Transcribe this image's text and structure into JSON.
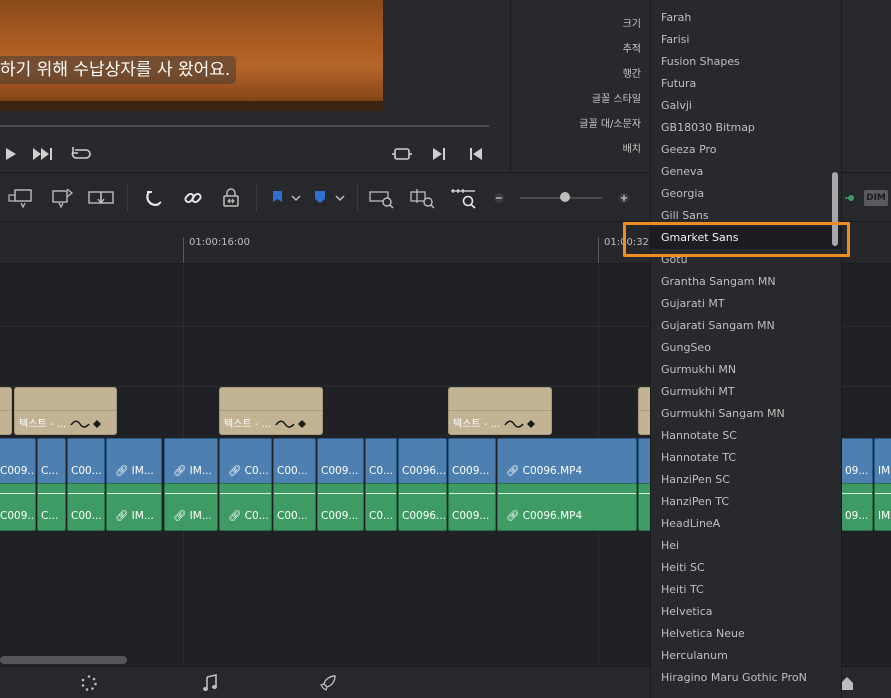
{
  "viewer": {
    "subtitle": "하기 위해 수납상자를 사 왔어요."
  },
  "inspector": {
    "labels": [
      "크기",
      "추적",
      "행간",
      "글꼴 스타일",
      "글꼴 대/소문자",
      "배치"
    ]
  },
  "toolbar": {
    "dim_label": "DIM"
  },
  "timeline": {
    "timecodes": [
      "01:00:16:00",
      "01:00:32:"
    ],
    "title_clip_label": "텍스트 - ...",
    "video_clips": [
      {
        "label": "C009..."
      },
      {
        "label": "C..."
      },
      {
        "label": "C00..."
      },
      {
        "label": "IM..."
      },
      {
        "label": "IM..."
      },
      {
        "label": "C0..."
      },
      {
        "label": "C00..."
      },
      {
        "label": "C009..."
      },
      {
        "label": "C0..."
      },
      {
        "label": "C0096..."
      },
      {
        "label": "C009..."
      },
      {
        "label": "C0096.MP4"
      },
      {
        "label": "09..."
      },
      {
        "label": "IM"
      }
    ],
    "audio_clips": [
      {
        "label": "C009..."
      },
      {
        "label": "C..."
      },
      {
        "label": "C00..."
      },
      {
        "label": "IM..."
      },
      {
        "label": "IM..."
      },
      {
        "label": "C0..."
      },
      {
        "label": "C00..."
      },
      {
        "label": "C009..."
      },
      {
        "label": "C0..."
      },
      {
        "label": "C0096..."
      },
      {
        "label": "C009..."
      },
      {
        "label": "C0096.MP4"
      },
      {
        "label": "09..."
      },
      {
        "label": "IM"
      }
    ]
  },
  "font_dropdown": {
    "selected": "Gmarket Sans",
    "items": [
      "Farah",
      "Farisi",
      "Fusion Shapes",
      "Futura",
      "Galvji",
      "GB18030 Bitmap",
      "Geeza Pro",
      "Geneva",
      "Georgia",
      "Gill Sans",
      "Gmarket Sans",
      "Gotu",
      "Grantha Sangam MN",
      "Gujarati MT",
      "Gujarati Sangam MN",
      "GungSeo",
      "Gurmukhi MN",
      "Gurmukhi MT",
      "Gurmukhi Sangam MN",
      "Hannotate SC",
      "Hannotate TC",
      "HanziPen SC",
      "HanziPen TC",
      "HeadLineA",
      "Hei",
      "Heiti SC",
      "Heiti TC",
      "Helvetica",
      "Helvetica Neue",
      "Herculanum",
      "Hiragino Maru Gothic ProN"
    ]
  },
  "colors": {
    "accent_focus": "#f08c23",
    "video_clip": "#4d7fb0",
    "audio_clip": "#3f9b64",
    "title_clip": "#c1b393",
    "marker_blue": "#2f6fd0"
  }
}
